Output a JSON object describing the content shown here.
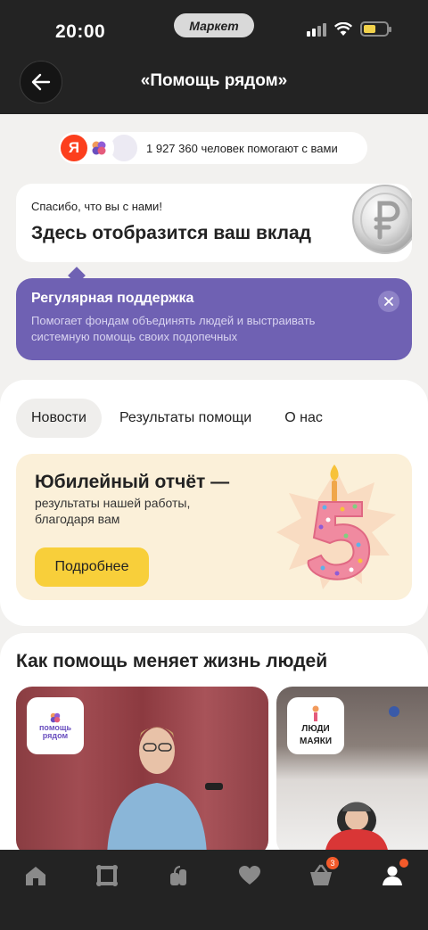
{
  "status_bar": {
    "time": "20:00",
    "app_pill": "Маркет"
  },
  "header": {
    "title": "«Помощь рядом»"
  },
  "helpers": {
    "avatar_letter": "Я",
    "count_text": "1 927 360 человек помогают с вами"
  },
  "contribution": {
    "subtitle": "Спасибо, что вы с нами!",
    "title": "Здесь отобразится ваш вклад"
  },
  "tooltip": {
    "title": "Регулярная поддержка",
    "description": "Помогает фондам объединять людей и выстраивать системную помощь своих подопечных"
  },
  "tabs": [
    {
      "label": "Новости",
      "active": true
    },
    {
      "label": "Результаты помощи",
      "active": false
    },
    {
      "label": "О нас",
      "active": false
    }
  ],
  "promo": {
    "title": "Юбилейный отчёт —",
    "description": "результаты нашей работы, благодаря вам",
    "button_label": "Подробнее"
  },
  "stories": {
    "title": "Как помощь меняет жизнь людей",
    "cards": [
      {
        "badge_line1": "помощь",
        "badge_line2": "рядом"
      },
      {
        "badge_line1": "ЛЮДИ",
        "badge_line2": "МАЯКИ"
      }
    ]
  },
  "bottom_nav": {
    "items": [
      "home-icon",
      "catalog-icon",
      "products-icon",
      "favorites-icon",
      "cart-icon",
      "profile-icon"
    ],
    "cart_badge": "3"
  },
  "colors": {
    "header_bg": "#232323",
    "tooltip_bg": "#6f61b3",
    "promo_bg": "#fbf0d9",
    "button_yellow": "#f8cf3a",
    "accent_red": "#fc3f1d"
  }
}
